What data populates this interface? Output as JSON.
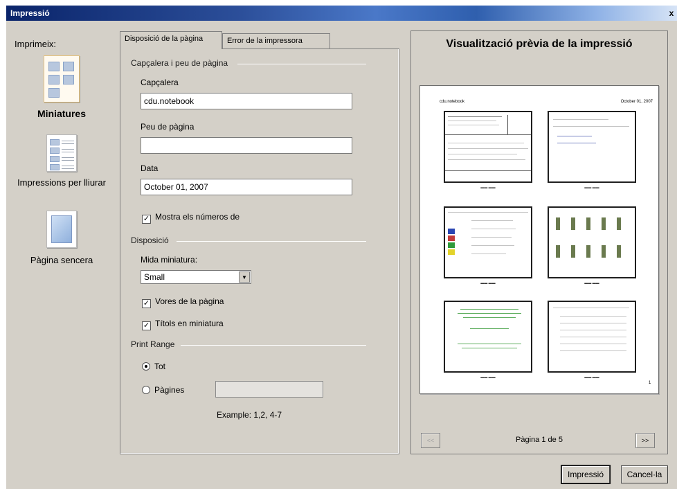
{
  "window": {
    "title": "Impressió",
    "close_glyph": "x"
  },
  "left_rail": {
    "print_label": "Imprimeix:",
    "modes": [
      {
        "id": "thumbnails",
        "label": "Miniatures",
        "selected": true,
        "icon": "thumbnails-icon"
      },
      {
        "id": "handouts",
        "label": "Impressions per lliurar",
        "selected": false,
        "icon": "handouts-icon"
      },
      {
        "id": "full_page",
        "label": "Pàgina sencera",
        "selected": false,
        "icon": "full-page-icon"
      }
    ]
  },
  "tabs": [
    {
      "label": "Disposició de la pàgina",
      "active": true
    },
    {
      "label": "Error de la impressora",
      "active": false
    }
  ],
  "header_footer": {
    "group_title": "Capçalera i peu de pàgina",
    "header_label": "Capçalera",
    "header_value": "cdu.notebook",
    "footer_label": "Peu de pàgina",
    "footer_value": "",
    "date_label": "Data",
    "date_value": "October 01, 2007",
    "show_numbers_label": "Mostra els números de",
    "show_numbers_checked": true
  },
  "layout": {
    "group_title": "Disposició",
    "thumb_size_label": "Mida miniatura:",
    "thumb_size_value": "Small",
    "page_borders_label": "Vores de la pàgina",
    "page_borders_checked": true,
    "thumb_titles_label": "Títols en miniatura",
    "thumb_titles_checked": true
  },
  "print_range": {
    "group_title": "Print Range",
    "all_label": "Tot",
    "pages_label": "Pàgines",
    "selected": "all",
    "pages_value": "",
    "example": "Example:  1,2, 4-7"
  },
  "preview": {
    "title": "Visualització prèvia de la impressió",
    "sheet_header_left": "cdu.notebook",
    "sheet_header_right": "October 01, 2007",
    "page_indicator": "Pàgina 1 de 5",
    "prev_label": "<<",
    "next_label": ">>",
    "page_number": "1"
  },
  "buttons": {
    "print": "Impressió",
    "cancel": "Cancel·la"
  },
  "colors": {
    "dialog_bg": "#d4d0c8",
    "title_bar_start": "#0a246a",
    "title_bar_end": "#d7e4f6"
  }
}
